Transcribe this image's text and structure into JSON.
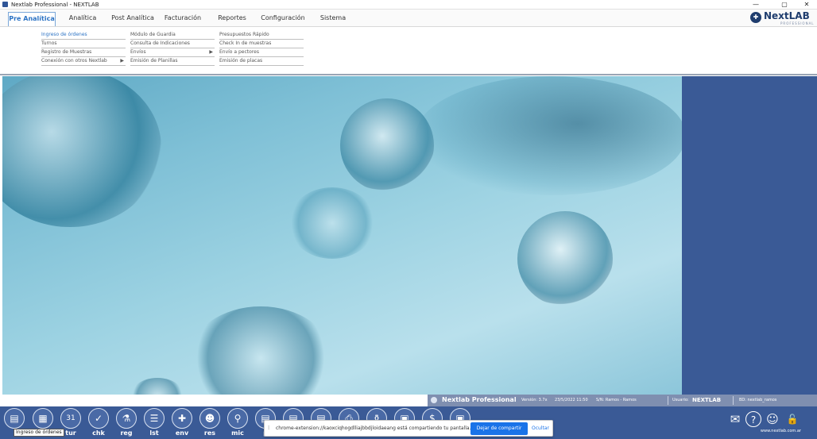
{
  "window": {
    "title": "Nextlab Professional - NEXTLAB",
    "controls": {
      "minimize": "—",
      "maximize": "▢",
      "close": "✕"
    }
  },
  "menu": {
    "tabs": [
      {
        "label": "Pre Analítica",
        "active": true
      },
      {
        "label": "Analítica"
      },
      {
        "label": "Post Analítica"
      },
      {
        "label": "Facturación"
      },
      {
        "label": "Reportes"
      },
      {
        "label": "Configuración"
      },
      {
        "label": "Sistema"
      }
    ]
  },
  "logo": {
    "name": "NextLAB",
    "tagline": "PROFESSIONAL"
  },
  "submenu": {
    "col1": [
      {
        "label": "Ingreso de órdenes",
        "active": true
      },
      {
        "label": "Turnos"
      },
      {
        "label": "Registro de Muestras"
      },
      {
        "label": "Conexión con otros Nextlab",
        "arrow": "▶"
      }
    ],
    "col2": [
      {
        "label": "Módulo de Guardia"
      },
      {
        "label": "Consulta de Indicaciones"
      },
      {
        "label": "Envíos",
        "arrow": "▶"
      },
      {
        "label": "Emisión de Planillas"
      }
    ],
    "col3": [
      {
        "label": "Presupuestos Rápido"
      },
      {
        "label": "Check In de muestras"
      },
      {
        "label": "Envío a pectores"
      },
      {
        "label": "Emisión de placas"
      }
    ]
  },
  "status": {
    "brand": "Nextlab Professional",
    "version": "Versión: 3.7x",
    "datetime": "23/5/2022 11:50",
    "sn": "S/N: Ramos - Ramos",
    "user_label": "Usuario:",
    "user": "NEXTLAB",
    "bd": "BD: nextlab_ramos"
  },
  "toolbar": {
    "buttons": [
      {
        "label": "",
        "icon": "document-icon",
        "glyph": "▤"
      },
      {
        "label": "",
        "icon": "calendar-grid-icon",
        "glyph": "▦"
      },
      {
        "label": "tur",
        "icon": "calendar-icon",
        "glyph": "31"
      },
      {
        "label": "chk",
        "icon": "check-icon",
        "glyph": "✓"
      },
      {
        "label": "reg",
        "icon": "sample-icon",
        "glyph": "⚗"
      },
      {
        "label": "lst",
        "icon": "list-icon",
        "glyph": "☰"
      },
      {
        "label": "env",
        "icon": "send-icon",
        "glyph": "✚"
      },
      {
        "label": "res",
        "icon": "person-icon",
        "glyph": "☻"
      },
      {
        "label": "mic",
        "icon": "microscope-icon",
        "glyph": "⚲"
      },
      {
        "label": "p",
        "icon": "page-icon",
        "glyph": "▤"
      },
      {
        "label": "",
        "icon": "page-icon",
        "glyph": "▤"
      },
      {
        "label": "",
        "icon": "page-icon",
        "glyph": "▤"
      },
      {
        "label": "",
        "icon": "printer-icon",
        "glyph": "⎙"
      },
      {
        "label": "",
        "icon": "bottle-icon",
        "glyph": "⚱"
      },
      {
        "label": "",
        "icon": "clipboard-icon",
        "glyph": "▣"
      },
      {
        "label": "",
        "icon": "money-icon",
        "glyph": "$"
      },
      {
        "label": "",
        "icon": "frame-icon",
        "glyph": "▣"
      }
    ],
    "right": [
      {
        "icon": "mail-icon",
        "glyph": "✉"
      },
      {
        "icon": "help-icon",
        "glyph": "?"
      },
      {
        "icon": "support-icon",
        "glyph": "☺"
      },
      {
        "icon": "lock-icon",
        "glyph": "🔓"
      }
    ],
    "site": "www.nextlab.com.ar"
  },
  "tooltip": "Ingreso de órdenes",
  "share": {
    "message": "chrome-extension://kaoxciqhogdlliajbbdjloidaeang está compartiendo tu pantalla.",
    "stop_label": "Dejar de compartir",
    "hide_label": "Ocultar"
  }
}
